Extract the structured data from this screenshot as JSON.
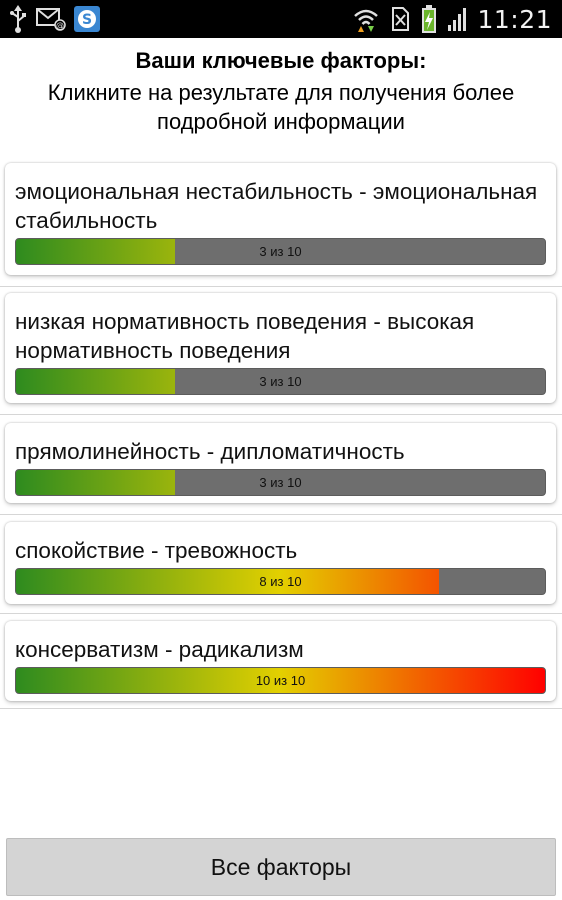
{
  "status_bar": {
    "time": "11:21",
    "icons": [
      "usb-icon",
      "mail-icon",
      "skype-icon",
      "wifi-icon",
      "no-sim-icon",
      "battery-charging-icon",
      "signal-icon"
    ]
  },
  "header": {
    "title": "Ваши ключевые факторы:",
    "subtitle": "Кликните на результате для получения более подробной информации"
  },
  "factors": [
    {
      "label": "эмоциональная нестабильность - эмоциональная стабильность",
      "score_text": "3 из 10",
      "score": 3,
      "max": 10
    },
    {
      "label": "низкая нормативность поведения - высокая нормативность поведения",
      "score_text": "3 из 10",
      "score": 3,
      "max": 10
    },
    {
      "label": "прямолинейность - дипломатичность",
      "score_text": "3 из 10",
      "score": 3,
      "max": 10
    },
    {
      "label": "спокойствие - тревожность",
      "score_text": "8 из 10",
      "score": 8,
      "max": 10
    },
    {
      "label": "консерватизм - радикализм",
      "score_text": "10 из 10",
      "score": 10,
      "max": 10
    }
  ],
  "bottom_button": {
    "label": "Все факторы"
  },
  "colors": {
    "gradient_start": "#2e8b1f",
    "gradient_mid": "#e3d000",
    "gradient_end": "#ff0000",
    "bar_empty": "#6e6e6e"
  }
}
